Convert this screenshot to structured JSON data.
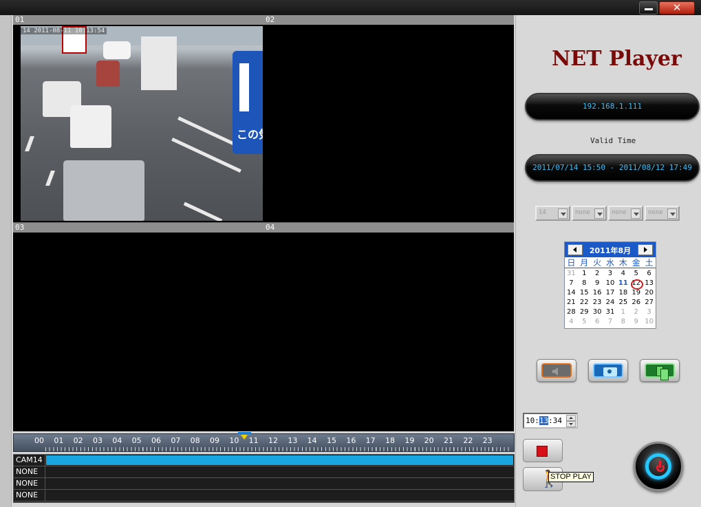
{
  "window": {
    "minimize_label": "",
    "close_label": "✕"
  },
  "panes": [
    {
      "id": "01",
      "osd": "14   2011-08-11  10:13:54"
    },
    {
      "id": "02"
    },
    {
      "id": "03"
    },
    {
      "id": "04"
    }
  ],
  "scene": {
    "sign_text": "この気"
  },
  "right": {
    "app_title": "NET Player",
    "ip_address": "192.168.1.111",
    "valid_label": "Valid Time",
    "valid_range": "2011/07/14 15:50 - 2011/08/12 17:49",
    "combos": [
      "14",
      "none",
      "none",
      "none"
    ]
  },
  "calendar": {
    "title": "2011年8月",
    "dows": [
      "日",
      "月",
      "火",
      "水",
      "木",
      "金",
      "土"
    ],
    "days": [
      {
        "d": "31",
        "m": true
      },
      {
        "d": "1"
      },
      {
        "d": "2"
      },
      {
        "d": "3"
      },
      {
        "d": "4"
      },
      {
        "d": "5"
      },
      {
        "d": "6"
      },
      {
        "d": "7"
      },
      {
        "d": "8"
      },
      {
        "d": "9"
      },
      {
        "d": "10"
      },
      {
        "d": "11",
        "today": true
      },
      {
        "d": "12",
        "sel": true
      },
      {
        "d": "13"
      },
      {
        "d": "14"
      },
      {
        "d": "15"
      },
      {
        "d": "16"
      },
      {
        "d": "17"
      },
      {
        "d": "18"
      },
      {
        "d": "19"
      },
      {
        "d": "20"
      },
      {
        "d": "21"
      },
      {
        "d": "22"
      },
      {
        "d": "23"
      },
      {
        "d": "24"
      },
      {
        "d": "25"
      },
      {
        "d": "26"
      },
      {
        "d": "27"
      },
      {
        "d": "28"
      },
      {
        "d": "29"
      },
      {
        "d": "30"
      },
      {
        "d": "31"
      },
      {
        "d": "1",
        "m": true
      },
      {
        "d": "2",
        "m": true
      },
      {
        "d": "3",
        "m": true
      },
      {
        "d": "4",
        "m": true
      },
      {
        "d": "5",
        "m": true
      },
      {
        "d": "6",
        "m": true
      },
      {
        "d": "7",
        "m": true
      },
      {
        "d": "8",
        "m": true
      },
      {
        "d": "9",
        "m": true
      },
      {
        "d": "10",
        "m": true
      }
    ]
  },
  "time": {
    "hour": "10",
    "minute": "13",
    "second": "34"
  },
  "tooltip": "STOP PLAY",
  "timeline": {
    "hours": [
      "00",
      "01",
      "02",
      "03",
      "04",
      "05",
      "06",
      "07",
      "08",
      "09",
      "10",
      "11",
      "12",
      "13",
      "14",
      "15",
      "16",
      "17",
      "18",
      "19",
      "20",
      "21",
      "22",
      "23"
    ]
  },
  "tracks": [
    {
      "label": "CAM14",
      "recorded": true
    },
    {
      "label": "NONE",
      "recorded": false
    },
    {
      "label": "NONE",
      "recorded": false
    },
    {
      "label": "NONE",
      "recorded": false
    }
  ],
  "colors": {
    "accent": "#1a59c7",
    "track": "#19a6e0",
    "title": "#7a0a0a",
    "readout": "#44bbf0"
  }
}
